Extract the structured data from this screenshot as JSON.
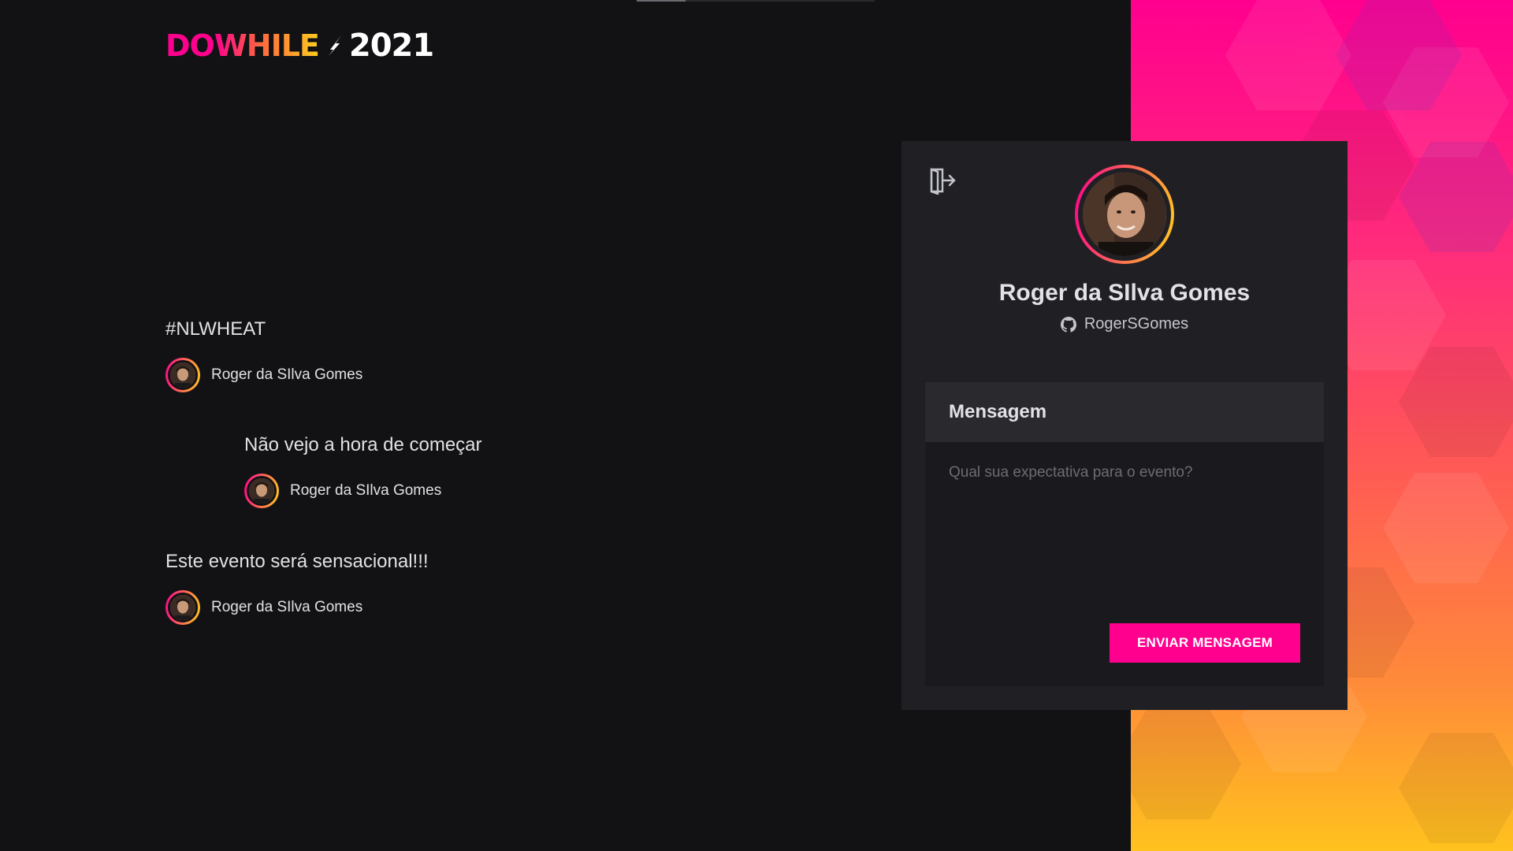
{
  "logo": {
    "part1": "DO",
    "part2": "WHILE",
    "year": "2021"
  },
  "messages": [
    {
      "text": "#NLWHEAT",
      "user": "Roger da SIlva Gomes"
    },
    {
      "text": "Não vejo a hora de começar",
      "user": "Roger da SIlva Gomes"
    },
    {
      "text": "Este evento será sensacional!!!",
      "user": "Roger da SIlva Gomes"
    }
  ],
  "profile": {
    "name": "Roger da SIlva Gomes",
    "login": "RogerSGomes"
  },
  "form": {
    "title": "Mensagem",
    "placeholder": "Qual sua expectativa para o evento?",
    "submit_label": "ENVIAR MENSAGEM"
  },
  "colors": {
    "accent": "#ff008e",
    "gradient_end": "#ffcd1e",
    "background": "#121214",
    "card": "#202024"
  },
  "icons": {
    "logout": "sign-out-icon",
    "github": "github-icon"
  }
}
